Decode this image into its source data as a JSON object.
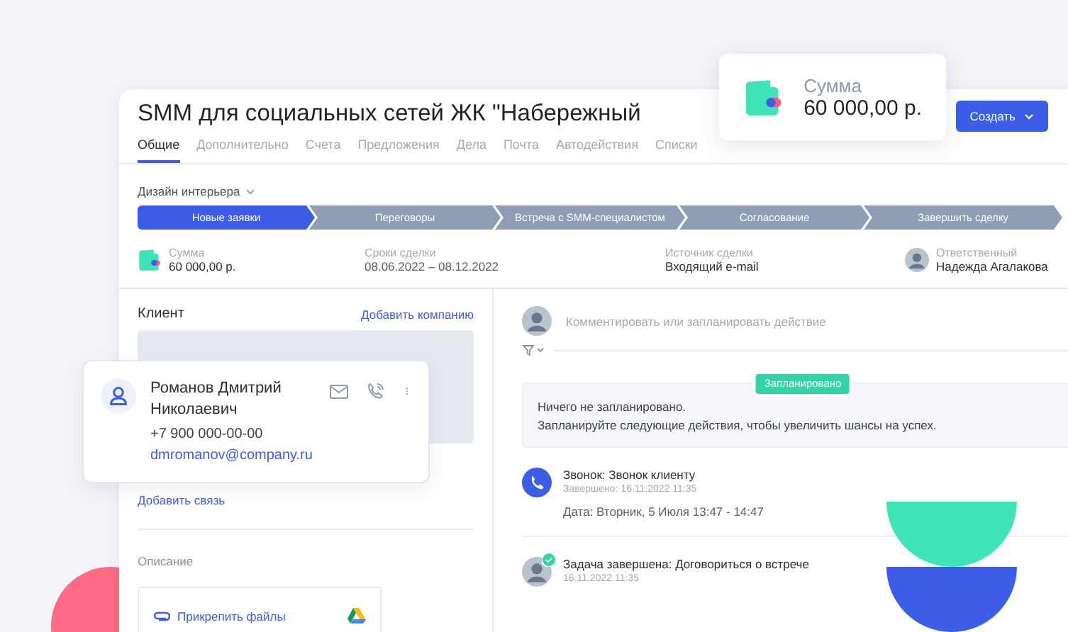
{
  "deal": {
    "title": "SMM для социальных сетей ЖК \"Набережный",
    "create_button": "Создать"
  },
  "summary_card": {
    "label": "Сумма",
    "value": "60 000,00 р."
  },
  "tabs": [
    {
      "label": "Общие",
      "selected": true
    },
    {
      "label": "Дополнительно",
      "selected": false
    },
    {
      "label": "Счета",
      "selected": false
    },
    {
      "label": "Предложения",
      "selected": false
    },
    {
      "label": "Дела",
      "selected": false
    },
    {
      "label": "Почта",
      "selected": false
    },
    {
      "label": "Автодействия",
      "selected": false
    },
    {
      "label": "Списки",
      "selected": false
    }
  ],
  "pipeline": {
    "name": "Дизайн интерьера",
    "stages": [
      {
        "label": "Новые заявки",
        "selected": true
      },
      {
        "label": "Переговоры",
        "selected": false
      },
      {
        "label": "Встреча с SMM-специалистом",
        "selected": false
      },
      {
        "label": "Согласование",
        "selected": false
      },
      {
        "label": "Завершить сделку",
        "selected": false
      }
    ]
  },
  "info": {
    "amount": {
      "label": "Сумма",
      "value": "60 000,00 р."
    },
    "dates": {
      "label": "Сроки сделки",
      "value": "08.06.2022  –  08.12.2022"
    },
    "source": {
      "label": "Источник сделки",
      "value": "Входящий e-mail"
    },
    "owner": {
      "label": "Ответственный",
      "value": "Надежда Агалакова"
    }
  },
  "client": {
    "title": "Клиент",
    "add_company": "Добавить компанию",
    "add_link": "Добавить связь",
    "description_label": "Описание",
    "attach": "Прикрепить файлы"
  },
  "contact": {
    "name": "Романов Дмитрий Николаевич",
    "phone": "+7 900 000-00-00",
    "email": "dmromanov@company.ru"
  },
  "feed": {
    "comment_placeholder": "Комментировать или запланировать действие",
    "planned_badge": "Запланировано",
    "planned_lines": [
      "Ничего не запланировано.",
      "Запланируйте следующие действия, чтобы увеличить шансы на успех."
    ],
    "events": [
      {
        "kind": "call",
        "title": "Звонок: Звонок клиенту",
        "status": "Завершено: 16.11.2022 11:35",
        "detail": "Дата: Вторник, 5 Июля 13:47 - 14:47"
      },
      {
        "kind": "task",
        "title": "Задача завершена: Договориться о встрече",
        "status": "16.11.2022 11:35"
      }
    ]
  }
}
